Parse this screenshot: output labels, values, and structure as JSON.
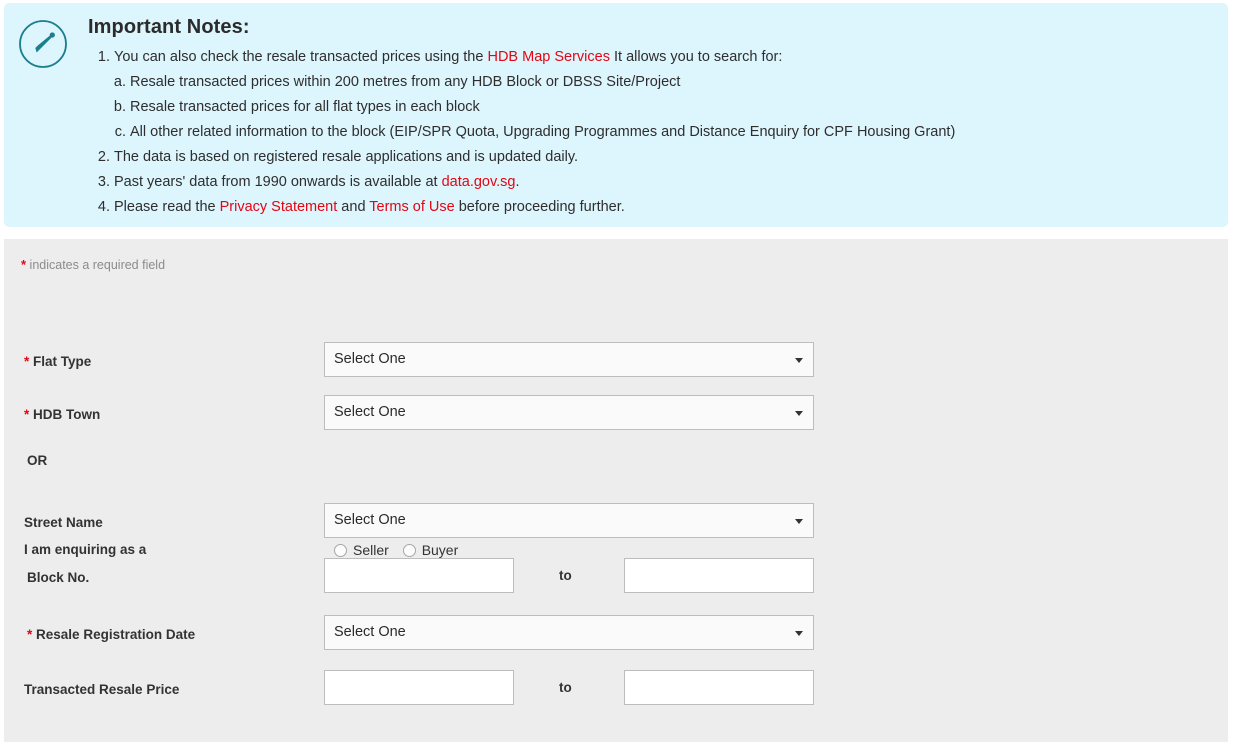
{
  "notes": {
    "icon": "pencil-circle-icon",
    "title": "Important Notes:",
    "items": [
      {
        "num": "1.",
        "parts": [
          {
            "t": "You can also check the resale transacted prices using the ",
            "link": false
          },
          {
            "t": "HDB Map Services",
            "link": true
          },
          {
            "t": " It allows you to search for:",
            "link": false
          }
        ],
        "sub": [
          {
            "num": "a.",
            "text": "Resale transacted prices within 200 metres from any HDB Block or DBSS Site/Project"
          },
          {
            "num": "b.",
            "text": "Resale transacted prices for all flat types in each block"
          },
          {
            "num": "c.",
            "text": "All other related information to the block (EIP/SPR Quota, Upgrading Programmes and Distance Enquiry for CPF Housing Grant)"
          }
        ]
      },
      {
        "num": "2.",
        "parts": [
          {
            "t": "The data is based on registered resale applications and is updated daily.",
            "link": false
          }
        ],
        "sub": []
      },
      {
        "num": "3.",
        "parts": [
          {
            "t": "Past years' data from 1990 onwards is available at ",
            "link": false
          },
          {
            "t": "data.gov.sg",
            "link": true
          },
          {
            "t": ".",
            "link": false
          }
        ],
        "sub": []
      },
      {
        "num": "4.",
        "parts": [
          {
            "t": "Please read the ",
            "link": false
          },
          {
            "t": "Privacy Statement",
            "link": true
          },
          {
            "t": " and ",
            "link": false
          },
          {
            "t": "Terms of Use",
            "link": true
          },
          {
            "t": " before proceeding further.",
            "link": false
          }
        ],
        "sub": []
      }
    ]
  },
  "form": {
    "required_hint": {
      "star": "*",
      "text": " indicates a required field"
    },
    "enquiring_as": {
      "label": "I am enquiring as a",
      "options": [
        {
          "label": "Seller",
          "selected": false
        },
        {
          "label": "Buyer",
          "selected": false
        }
      ]
    },
    "flat_type": {
      "label": "Flat Type",
      "required": true,
      "value": "Select One"
    },
    "hdb_town": {
      "label": "HDB Town",
      "required": true,
      "value": "Select One"
    },
    "or_label": "OR",
    "street_name": {
      "label": "Street Name",
      "required": false,
      "value": "Select One"
    },
    "block_no": {
      "label": "Block No.",
      "required": false,
      "from_value": "",
      "to_label": "to",
      "to_value": ""
    },
    "resale_registration_date": {
      "label": "Resale Registration Date",
      "required": true,
      "value": "Select One"
    },
    "transacted_resale_price": {
      "label": "Transacted Resale Price",
      "required": false,
      "from_value": "",
      "to_label": "to",
      "to_value": ""
    }
  },
  "colors": {
    "banner_bg": "#ddf5fd",
    "panel_bg": "#ededed",
    "link_red": "#e30613",
    "icon_teal": "#1a7f8e"
  }
}
